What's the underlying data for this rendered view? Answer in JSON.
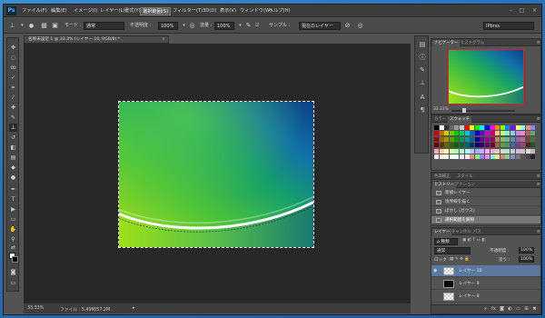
{
  "menu": {
    "logo": "Ps",
    "items": [
      "ファイル(F)",
      "編集(E)",
      "イメージ(I)",
      "レイヤー(L)",
      "書式(Y)",
      "選択範囲(S)",
      "フィルター(T)",
      "3D(D)",
      "表示(V)",
      "ウィンドウ(W)",
      "ヘルプ(H)"
    ],
    "active_index": 5
  },
  "options": {
    "mode_label": "モード :",
    "mode_value": "通常",
    "opacity_label": "不透明度 :",
    "opacity_value": "100%",
    "flow_label": "流量 :",
    "flow_value": "100%",
    "sample_label": "サンプル :",
    "sample_value": "現在のレイヤー",
    "workspace_value": "IPbrss"
  },
  "document": {
    "tab_title": "名称未設定 1 @ 33.3% (レイヤー 10, RGB/8) *"
  },
  "status": {
    "zoom": "33.33%",
    "file_info": "ファイル : 5.49M/57.2M"
  },
  "navigator": {
    "tabs": [
      "ナビゲーター",
      "ヒストグラム"
    ],
    "zoom": "33.33%",
    "slider_fraction": 0.18
  },
  "swatches": {
    "tabs": [
      "カラー",
      "スウォッチ"
    ]
  },
  "history": {
    "tabs": [
      "色調補正",
      "スタイル"
    ],
    "subtabs": [
      "ヒストリー",
      "アクション"
    ],
    "items": [
      "新規レイヤー",
      "境界線を描く",
      "ぼかし (ガウス)",
      "選択範囲を解除"
    ],
    "active_index": 3
  },
  "layers": {
    "tabs": [
      "レイヤー",
      "チャンネル",
      "パス"
    ],
    "kind_label": "ρ 種類",
    "blend_value": "通常",
    "opacity_label": "不透明度 :",
    "opacity_value": "100%",
    "lock_label": "ロック :",
    "fill_label": "塗り :",
    "fill_value": "100%",
    "rows": [
      {
        "name": "レイヤー 10",
        "thumb": "checker",
        "active": true
      },
      {
        "name": "レイヤー 9",
        "thumb": "black",
        "active": false
      },
      {
        "name": "レイヤー 8",
        "thumb": "checker",
        "active": false
      }
    ]
  },
  "colors": {
    "accent_active_layer": "#5c7aa0",
    "history_active": "#777777",
    "desktop_blue": "#2a6fb4"
  }
}
